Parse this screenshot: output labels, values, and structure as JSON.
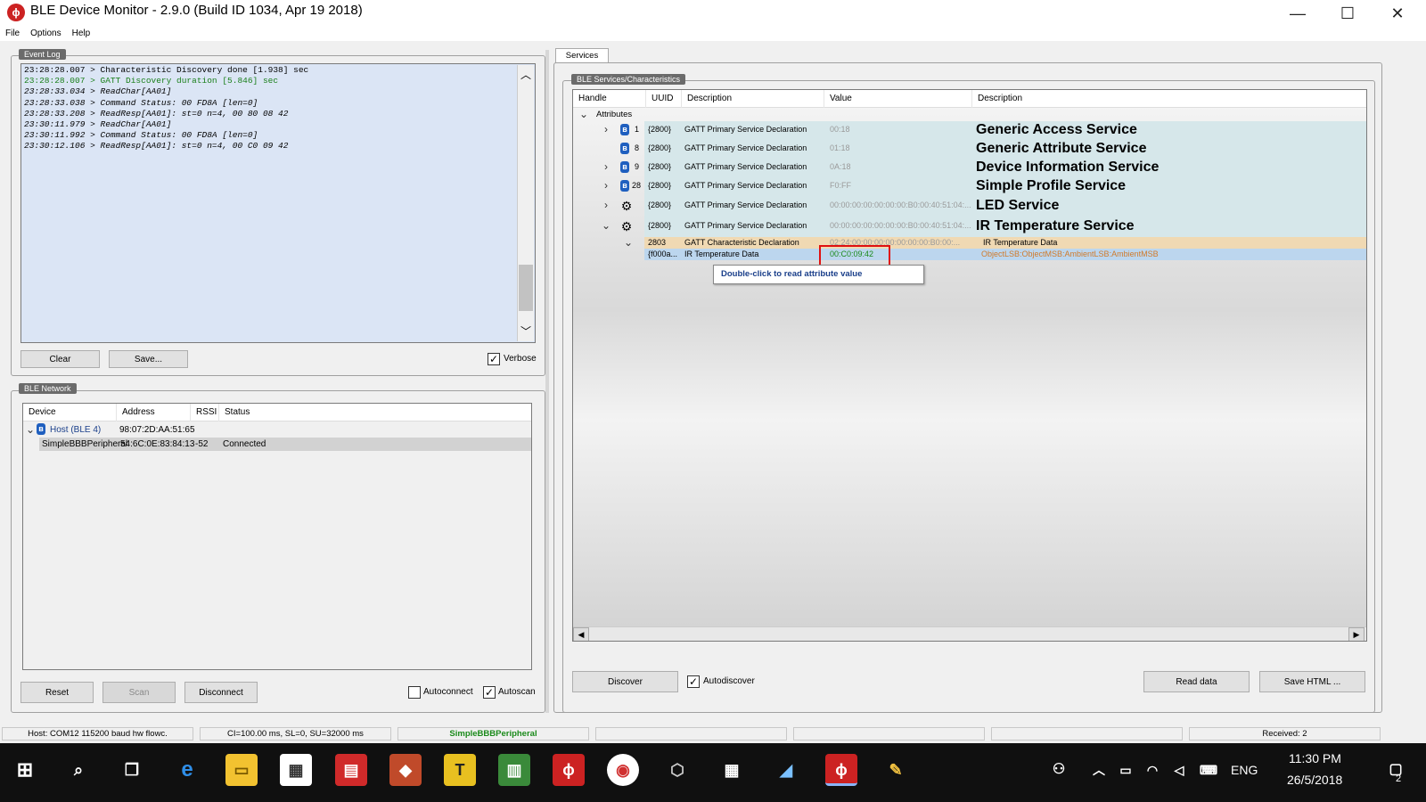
{
  "window": {
    "title": "BLE Device Monitor - 2.9.0 (Build ID 1034, Apr 19 2018)",
    "minimize": "—",
    "maximize": "☐",
    "close": "✕"
  },
  "menu": [
    "File",
    "Options",
    "Help"
  ],
  "event_log": {
    "title": "Event Log",
    "lines": [
      "23:28:28.007 > Characteristic Discovery done [1.938] sec",
      "23:28:28.007 > GATT Discovery duration [5.846] sec",
      "23:28:33.034 > ReadChar[AA01]",
      "23:28:33.038 > Command Status: 00 FD8A [len=0]",
      "23:28:33.208 > ReadResp[AA01]: st=0 n=4, 00 80 08 42",
      "23:30:11.979 > ReadChar[AA01]",
      "23:30:11.992 > Command Status: 00 FD8A [len=0]",
      "23:30:12.106 > ReadResp[AA01]: st=0 n=4, 00 C0 09 42"
    ],
    "highlight_color": "#1a7f1a",
    "clear_label": "Clear",
    "save_label": "Save...",
    "verbose_label": "Verbose"
  },
  "network": {
    "title": "BLE Network",
    "columns": [
      "Device",
      "Address",
      "RSSI",
      "Status"
    ],
    "host": {
      "name": "Host (BLE 4)",
      "address": "98:07:2D:AA:51:65"
    },
    "peripheral": {
      "name": "SimpleBBBPeripheral",
      "address": "54:6C:0E:83:84:13",
      "rssi": "-52",
      "status": "Connected"
    },
    "reset_label": "Reset",
    "scan_label": "Scan",
    "disconnect_label": "Disconnect",
    "autoconnect_label": "Autoconnect",
    "autoscan_label": "Autoscan"
  },
  "services": {
    "tab": "Services",
    "group_title": "BLE Services/Characteristics",
    "columns": [
      "Handle",
      "UUID",
      "Description",
      "Value",
      "Description"
    ],
    "root": "Attributes",
    "rows": [
      {
        "handle": "1",
        "uuid": "{2800}",
        "desc": "GATT Primary Service Declaration",
        "value": "00:18",
        "name": "Generic Access Service",
        "icon": "bluetooth-icon",
        "expand": "›"
      },
      {
        "handle": "8",
        "uuid": "{2800}",
        "desc": "GATT Primary Service Declaration",
        "value": "01:18",
        "name": "Generic Attribute Service",
        "icon": "bluetooth-icon",
        "expand": ""
      },
      {
        "handle": "9",
        "uuid": "{2800}",
        "desc": "GATT Primary Service Declaration",
        "value": "0A:18",
        "name": "Device Information Service",
        "icon": "bluetooth-icon",
        "expand": "›"
      },
      {
        "handle": "28",
        "uuid": "{2800}",
        "desc": "GATT Primary Service Declaration",
        "value": "F0:FF",
        "name": "Simple Profile Service",
        "icon": "bluetooth-icon",
        "expand": "›"
      },
      {
        "handle": "",
        "uuid": "{2800}",
        "desc": "GATT Primary Service Declaration",
        "value": "00:00:00:00:00:00:00:B0:00:40:51:04:...",
        "name": "LED Service",
        "icon": "ti-logo-icon",
        "expand": "›"
      },
      {
        "handle": "",
        "uuid": "{2800}",
        "desc": "GATT Primary Service Declaration",
        "value": "00:00:00:00:00:00:00:B0:00:40:51:04:...",
        "name": "IR Temperature Service",
        "icon": "ti-logo-icon",
        "expand": "⌄"
      }
    ],
    "char_decl": {
      "uuid": "2803",
      "desc": "GATT Characteristic Declaration",
      "value": "02:24:00:00:00:00:00:00:00:B0:00:...",
      "desc2": "IR Temperature Data"
    },
    "char_data": {
      "uuid": "{f000a...",
      "desc": "IR Temperature Data",
      "value": "00:C0:09:42",
      "desc2": "ObjectLSB:ObjectMSB:AmbientLSB:AmbientMSB"
    },
    "tooltip": "Double-click to read attribute value",
    "discover_label": "Discover",
    "autodiscover_label": "Autodiscover",
    "read_label": "Read data",
    "save_html_label": "Save HTML ..."
  },
  "statusbar": {
    "host": "Host: COM12 115200 baud hw flowc.",
    "conn": "CI=100.00 ms, SL=0, SU=32000 ms",
    "device": "SimpleBBBPeripheral",
    "received": "Received: 2"
  },
  "taskbar": {
    "lang": "ENG",
    "time": "11:30 PM",
    "date": "26/5/2018",
    "notif_count": "2"
  },
  "colors": {
    "accent_ti": "#cc2222",
    "service_row_bg": "#d6e7ea",
    "char_decl_bg": "#f0d9b3",
    "selected_bg": "#bcd6ee",
    "value_green": "#1a8a1a",
    "highlight_box": "#e01010"
  }
}
